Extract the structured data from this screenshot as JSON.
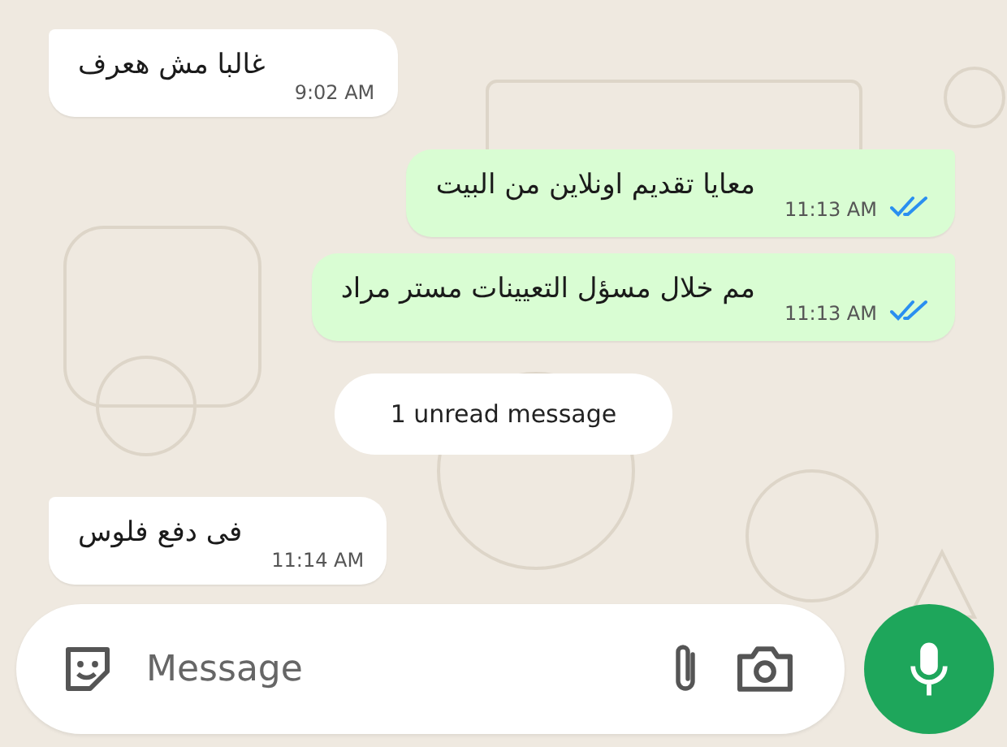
{
  "messages": [
    {
      "kind": "incoming",
      "text": "غالبا مش هعرف",
      "time": "9:02 AM",
      "read": false
    },
    {
      "kind": "outgoing",
      "text": "معايا تقديم اونلاين من البيت",
      "time": "11:13 AM",
      "read": true
    },
    {
      "kind": "outgoing",
      "text": "مم خلال مسؤل التعيينات مستر مراد",
      "time": "11:13 AM",
      "read": true
    },
    {
      "kind": "notice",
      "text": "1 unread message"
    },
    {
      "kind": "incoming",
      "text": "فى دفع فلوس",
      "time": "11:14 AM",
      "read": false
    }
  ],
  "composer": {
    "placeholder": "Message"
  }
}
